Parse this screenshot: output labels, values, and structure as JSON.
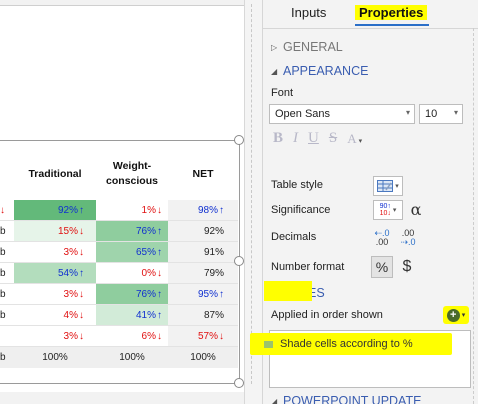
{
  "table": {
    "headers": [
      "Traditional",
      "Weight-\nconscious",
      "NET"
    ],
    "header_lines": [
      [
        "Traditional"
      ],
      [
        "Weight-",
        "conscious"
      ],
      [
        "NET"
      ]
    ],
    "rows": [
      {
        "left_stub": "↓",
        "left_dir": "down",
        "c1": {
          "text": "92%",
          "dir": "up",
          "bg": "#63b97a"
        },
        "c2": {
          "text": "1%",
          "dir": "down",
          "bg": "#ffffff"
        },
        "c3": {
          "text": "98%",
          "dir": "up"
        }
      },
      {
        "left_stub": "b",
        "left_dir": "plain",
        "c1": {
          "text": "15%",
          "dir": "down",
          "bg": "#e6f4e9"
        },
        "c2": {
          "text": "76%",
          "dir": "up",
          "bg": "#8fcd9e"
        },
        "c3": {
          "text": "92%",
          "dir": "none"
        }
      },
      {
        "left_stub": "b",
        "left_dir": "plain",
        "c1": {
          "text": "3%",
          "dir": "down",
          "bg": "#ffffff"
        },
        "c2": {
          "text": "65%",
          "dir": "up",
          "bg": "#9fd4ac"
        },
        "c3": {
          "text": "91%",
          "dir": "none"
        }
      },
      {
        "left_stub": "b",
        "left_dir": "plain",
        "c1": {
          "text": "54%",
          "dir": "up",
          "bg": "#b3ddbd"
        },
        "c2": {
          "text": "0%",
          "dir": "down",
          "bg": "#ffffff"
        },
        "c3": {
          "text": "79%",
          "dir": "none"
        }
      },
      {
        "left_stub": "b",
        "left_dir": "plain",
        "c1": {
          "text": "3%",
          "dir": "down",
          "bg": "#ffffff"
        },
        "c2": {
          "text": "76%",
          "dir": "up",
          "bg": "#8fcd9e"
        },
        "c3": {
          "text": "95%",
          "dir": "up"
        }
      },
      {
        "left_stub": "b",
        "left_dir": "plain",
        "c1": {
          "text": "4%",
          "dir": "down",
          "bg": "#ffffff"
        },
        "c2": {
          "text": "41%",
          "dir": "up",
          "bg": "#d2ebd8"
        },
        "c3": {
          "text": "87%",
          "dir": "none"
        }
      },
      {
        "left_stub": "",
        "left_dir": "plain",
        "c1": {
          "text": "3%",
          "dir": "down",
          "bg": "#ffffff"
        },
        "c2": {
          "text": "6%",
          "dir": "down",
          "bg": "#ffffff"
        },
        "c3": {
          "text": "57%",
          "dir": "down"
        }
      }
    ],
    "total_row": {
      "left_stub": "b",
      "c1": "100%",
      "c2": "100%",
      "c3": "100%"
    }
  },
  "panel": {
    "tabs": {
      "inputs": "Inputs",
      "properties": "Properties"
    },
    "sections": {
      "general": "GENERAL",
      "appearance": "APPEARANCE",
      "rules": "RULES",
      "powerpoint_update": "POWERPOINT UPDATE"
    },
    "font": {
      "label": "Font",
      "family_value": "Open Sans",
      "size_value": "10"
    },
    "format_buttons": {
      "bold": "B",
      "italic": "I",
      "underline": "U",
      "strike": "S",
      "color": "A"
    },
    "table_style_label": "Table style",
    "significance_label": "Significance",
    "decimals_label": "Decimals",
    "number_format_label": "Number format",
    "decimals_increase": ".0",
    "decimals_increase_sub": ".00",
    "decimals_decrease": ".00",
    "decimals_decrease_sub": ".0",
    "percent_symbol": "%",
    "dollar_symbol": "$",
    "significance_icon_top": "90↑",
    "significance_icon_bottom": "10↓",
    "alpha_symbol": "α",
    "rules_applied_label": "Applied in order shown",
    "rules": [
      {
        "label": "Shade cells according to %"
      }
    ]
  },
  "colors": {
    "up_arrow": "#1030d0",
    "down_arrow": "#e01010",
    "highlight": "#ffff00",
    "accent": "#2b6fc8",
    "section_heading": "#3a5db0"
  },
  "icons": {
    "up": "↑",
    "down": "↓",
    "collapsed": "▷",
    "expanded": "◢",
    "caret": "▾",
    "plus": "+"
  }
}
